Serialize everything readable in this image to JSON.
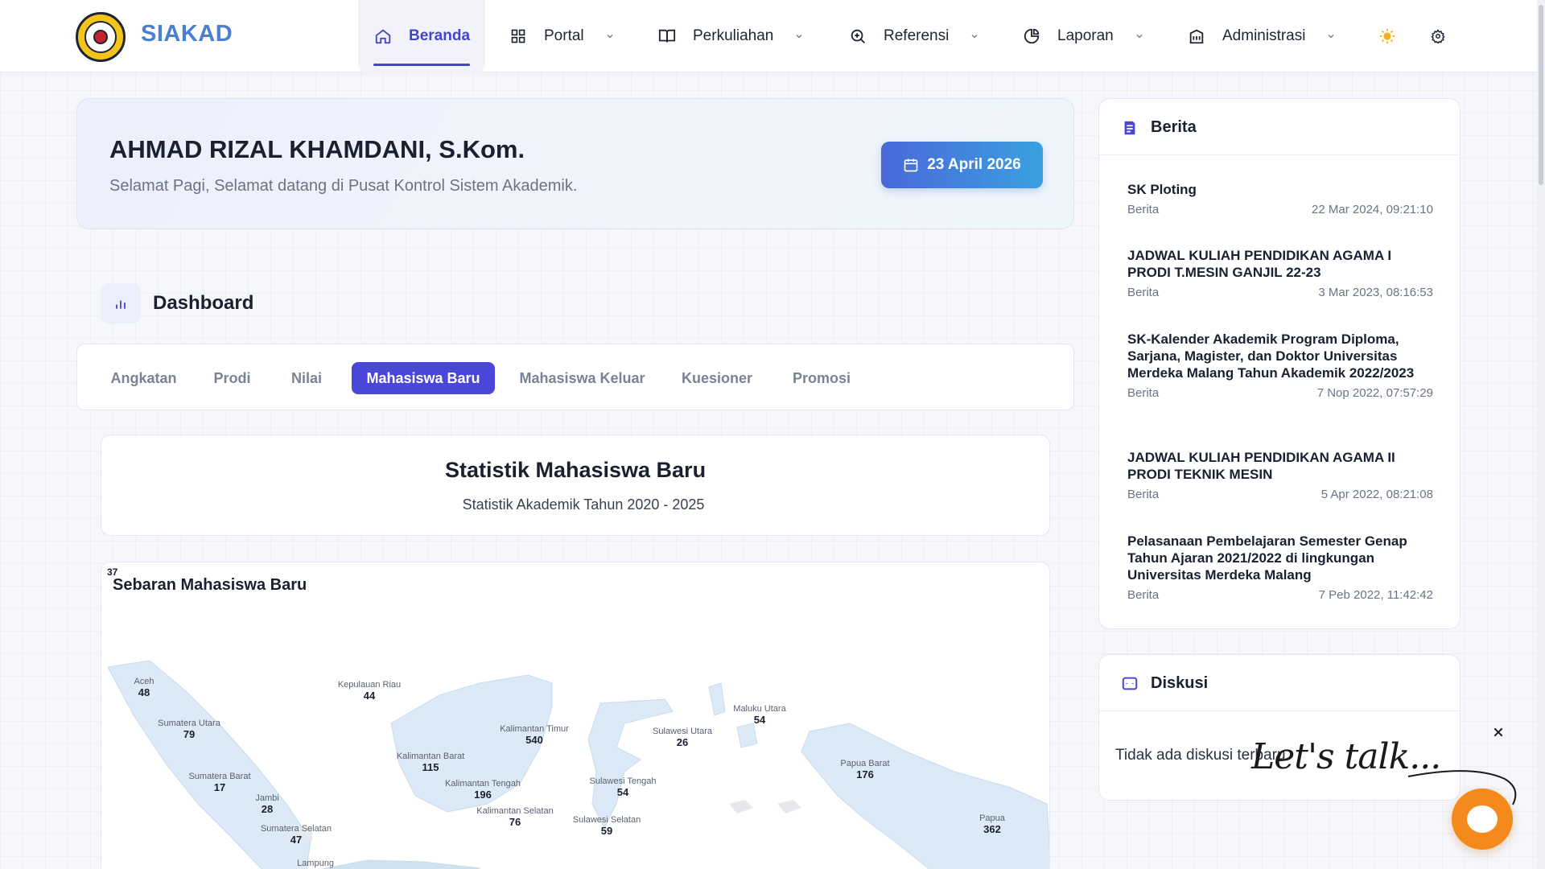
{
  "app": {
    "brand": "SIAKAD"
  },
  "nav": {
    "items": [
      {
        "label": "Beranda",
        "icon": "home-icon",
        "active": true
      },
      {
        "label": "Portal",
        "icon": "grid-icon"
      },
      {
        "label": "Perkuliahan",
        "icon": "book-icon"
      },
      {
        "label": "Referensi",
        "icon": "search-icon"
      },
      {
        "label": "Laporan",
        "icon": "pie-chart-icon"
      },
      {
        "label": "Administrasi",
        "icon": "building-icon"
      }
    ],
    "theme_icon": "sun-icon",
    "settings_icon": "gear-icon"
  },
  "welcome": {
    "name": "AHMAD RIZAL KHAMDANI, S.Kom.",
    "greeting": "Selamat Pagi, Selamat datang di Pusat Kontrol Sistem Akademik.",
    "date": "23 April 2026"
  },
  "dashboard": {
    "title": "Dashboard",
    "tabs": [
      "Angkatan",
      "Prodi",
      "Nilai",
      "Mahasiswa Baru",
      "Mahasiswa Keluar",
      "Kuesioner",
      "Promosi"
    ],
    "active_tab": "Mahasiswa Baru"
  },
  "stats": {
    "title": "Statistik Mahasiswa Baru",
    "subtitle": "Statistik Akademik Tahun 2020 - 2025"
  },
  "map": {
    "tag": "37",
    "title": "Sebaran Mahasiswa Baru",
    "provinces": [
      {
        "name": "Aceh",
        "value": "48"
      },
      {
        "name": "Sumatera Utara",
        "value": "79"
      },
      {
        "name": "Sumatera Barat",
        "value": "17"
      },
      {
        "name": "Jambi",
        "value": "28"
      },
      {
        "name": "Sumatera Selatan",
        "value": "47"
      },
      {
        "name": "Lampung",
        "value": ""
      },
      {
        "name": "Kepulauan Riau",
        "value": "44"
      },
      {
        "name": "Kalimantan Barat",
        "value": "115"
      },
      {
        "name": "Kalimantan Tengah",
        "value": "196"
      },
      {
        "name": "Kalimantan Selatan",
        "value": "76"
      },
      {
        "name": "Kalimantan Timur",
        "value": "540"
      },
      {
        "name": "Sulawesi Utara",
        "value": "26"
      },
      {
        "name": "Sulawesi Tengah",
        "value": "54"
      },
      {
        "name": "Sulawesi Selatan",
        "value": "59"
      },
      {
        "name": "Maluku Utara",
        "value": "54"
      },
      {
        "name": "Papua Barat",
        "value": "176"
      },
      {
        "name": "Papua",
        "value": "362"
      }
    ]
  },
  "berita": {
    "title": "Berita",
    "items": [
      {
        "title": "SK Ploting",
        "category": "Berita",
        "date": "22 Mar 2024, 09:21:10"
      },
      {
        "title": "JADWAL KULIAH PENDIDIKAN AGAMA I PRODI T.MESIN GANJIL 22-23",
        "category": "Berita",
        "date": "3 Mar 2023, 08:16:53"
      },
      {
        "title": "SK-Kalender Akademik Program Diploma, Sarjana, Magister, dan Doktor Universitas Merdeka Malang Tahun Akademik 2022/2023",
        "category": "Berita",
        "date": "7 Nop 2022, 07:57:29"
      },
      {
        "title": "JADWAL KULIAH PENDIDIKAN AGAMA II PRODI TEKNIK MESIN",
        "category": "Berita",
        "date": "5 Apr 2022, 08:21:08"
      },
      {
        "title": "Pelasanaan Pembelajaran Semester Genap Tahun Ajaran 2021/2022 di lingkungan Universitas Merdeka Malang",
        "category": "Berita",
        "date": "7 Peb 2022, 11:42:42"
      }
    ]
  },
  "diskusi": {
    "title": "Diskusi",
    "empty": "Tidak ada diskusi terbaru."
  },
  "chat": {
    "label": "Let's talk..."
  },
  "colors": {
    "primary": "#4a47d8",
    "brand": "#4a7fd1",
    "chat": "#f48a1c"
  }
}
